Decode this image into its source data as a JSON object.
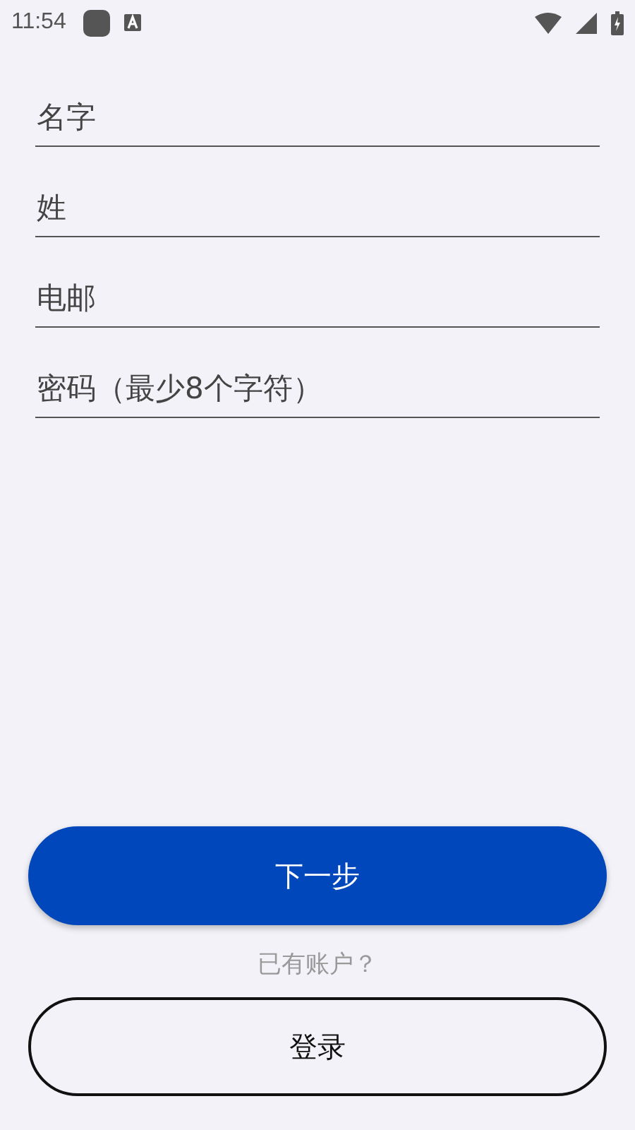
{
  "status_bar": {
    "time": "11:54"
  },
  "fields": [
    {
      "placeholder": "名字"
    },
    {
      "placeholder": "姓"
    },
    {
      "placeholder": "电邮"
    },
    {
      "placeholder": "密码（最少8个字符）"
    }
  ],
  "next_button": "下一步",
  "account_prompt": "已有账户？",
  "login_button": "登录"
}
